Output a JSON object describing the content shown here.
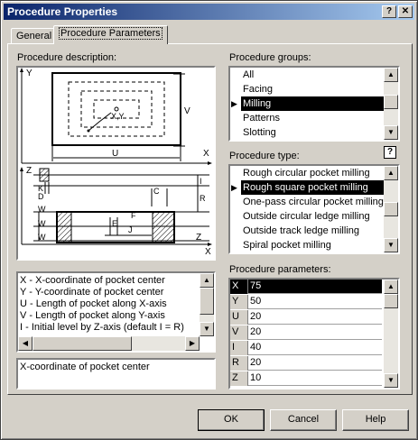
{
  "window": {
    "title": "Procedure Properties",
    "help_btn": "?",
    "close_btn": "✕"
  },
  "tabs": [
    {
      "label": "General"
    },
    {
      "label": "Procedure Parameters"
    }
  ],
  "description": {
    "label": "Procedure description:",
    "lines": [
      "X - X-coordinate of pocket center",
      "Y - Y-coordinate of pocket center",
      "U - Length of pocket along X-axis",
      "V - Length of pocket along Y-axis",
      "I - Initial level by Z-axis (default I = R)"
    ],
    "hint": "X-coordinate of pocket center"
  },
  "diagram": {
    "top": {
      "y": "Y",
      "x": "X",
      "u": "U",
      "v": "V",
      "point": "X,Y"
    },
    "side": {
      "z": "Z",
      "x": "X",
      "k": "K",
      "d": "D",
      "c": "C",
      "i": "I",
      "r": "R",
      "w1": "W",
      "w2": "W",
      "w3": "W",
      "e": "E",
      "f": "F",
      "j": "J"
    }
  },
  "groups": {
    "label": "Procedure groups:",
    "items": [
      "All",
      "Facing",
      "Milling",
      "Patterns",
      "Slotting"
    ],
    "selected": 2
  },
  "types": {
    "label": "Procedure type:",
    "items": [
      "Rough circular pocket milling",
      "Rough square pocket milling",
      "One-pass circular pocket milling",
      "Outside circular ledge milling",
      "Outside track ledge milling",
      "Spiral pocket milling"
    ],
    "selected": 1,
    "help_icon": "?"
  },
  "params": {
    "label": "Procedure parameters:",
    "rows": [
      {
        "k": "X",
        "v": "75"
      },
      {
        "k": "Y",
        "v": "50"
      },
      {
        "k": "U",
        "v": "20"
      },
      {
        "k": "V",
        "v": "20"
      },
      {
        "k": "I",
        "v": "40"
      },
      {
        "k": "R",
        "v": "20"
      },
      {
        "k": "Z",
        "v": "10"
      }
    ],
    "selected": 0
  },
  "buttons": {
    "ok": "OK",
    "cancel": "Cancel",
    "help": "Help"
  },
  "scroll_arrows": {
    "up": "▲",
    "down": "▼",
    "left": "◀",
    "right": "▶"
  },
  "marker": "▶"
}
